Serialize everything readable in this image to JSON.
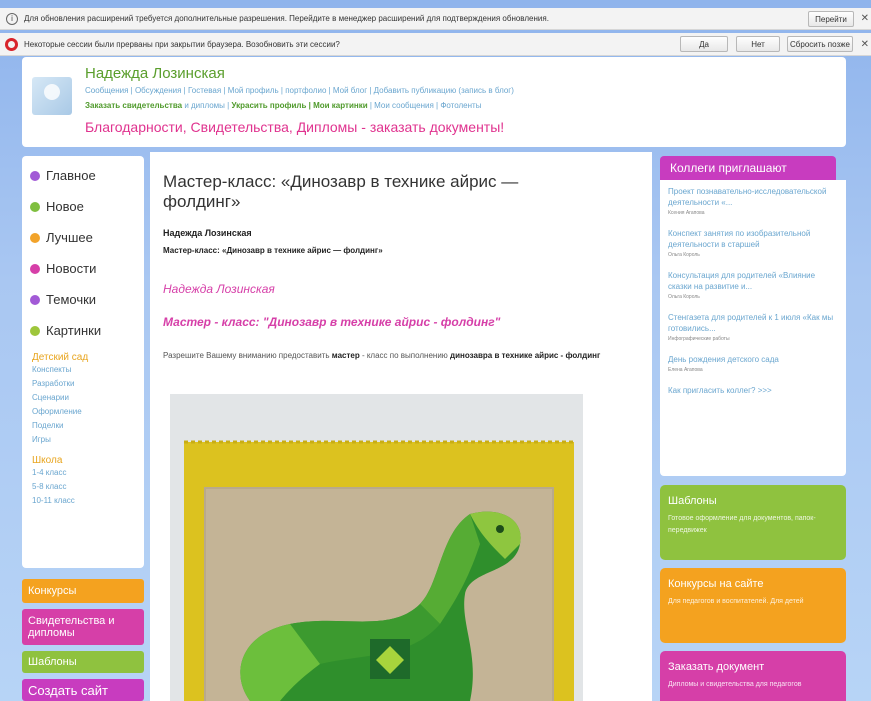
{
  "browser": {
    "bar1_text": "Для обновления расширений требуется дополнительные разрешения. Перейдите в менеджер расширений для подтверждения обновления.",
    "bar1_button": "Перейти",
    "bar2_text": "Некоторые сессии были прерваны при закрытии браузера. Возобновить эти сессии?",
    "bar2_buttons": [
      "Да",
      "Нет",
      "Сбросить позже"
    ],
    "info_icon": "i"
  },
  "header": {
    "user_name": "Надежда Лозинская",
    "links_line1": "Сообщения | Обсуждения | Гостевая | Мой профиль | портфолио | Мой блог | Добавить публикацию (запись в блог)",
    "links_line2_green1": "Заказать свидетельства",
    "links_line2_blue1": " и дипломы | ",
    "links_line2_green2": "Украсить профиль | Мои картинки",
    "links_line2_blue2": " | Мои сообщения | Фотоленты",
    "promo": "Благодарности, Свидетельства, Дипломы - заказать документы!"
  },
  "left_nav": {
    "items": [
      {
        "label": "Главное",
        "color": "#a25ad6"
      },
      {
        "label": "Новое",
        "color": "#7fbf3f"
      },
      {
        "label": "Лучшее",
        "color": "#f2a32a"
      },
      {
        "label": "Новости",
        "color": "#d63fa8"
      },
      {
        "label": "Темочки",
        "color": "#a25ad6"
      },
      {
        "label": "Картинки",
        "color": "#9ec63b"
      }
    ],
    "section1": {
      "title": "Детский сад",
      "links": [
        "Конспекты",
        "Разработки",
        "Сценарии",
        "Оформление",
        "Поделки",
        "Игры"
      ]
    },
    "section2": {
      "title": "Школа",
      "links": [
        "1-4 класс",
        "5-8 класс",
        "10-11 класс"
      ]
    },
    "buttons": [
      {
        "label": "Конкурсы",
        "color": "#f4a21f"
      },
      {
        "label": "Свидетельства и дипломы",
        "color": "#d63fa8"
      },
      {
        "label": "Шаблоны",
        "color": "#8fc23f"
      },
      {
        "label": "Создать сайт",
        "color": "#c83cbf"
      }
    ]
  },
  "article": {
    "title": "Мастер-класс: «Динозавр в технике айрис — фолдинг»",
    "author": "Надежда Лозинская",
    "subtitle": "Мастер-класс: «Динозавр в технике айрис — фолдинг»",
    "author_pink": "Надежда Лозинская",
    "mk_pink": "Мастер - класс: \"Динозавр в технике айрис - фолдинг\"",
    "intro_prefix": "Разрешите Вашему вниманию предоставить ",
    "intro_bold1": "мастер",
    "intro_mid": " - класс по выполнению ",
    "intro_bold2": "динозавра в технике айрис - фолдинг"
  },
  "colleagues": {
    "heading": "Коллеги приглашают",
    "items": [
      {
        "link": "Проект познавательно-исследовательской деятельности «...",
        "sub": "Ксения Агапова"
      },
      {
        "link": "Конспект занятия по изобразительной деятельности в старшей",
        "sub": "Ольга Король"
      },
      {
        "link": "Консультация для родителей «Влияние сказки на развитие и...",
        "sub": "Ольга Король"
      },
      {
        "link": "Стенгазета для родителей к 1 июля «Как мы готовились...",
        "sub": "Инфографические работы"
      },
      {
        "link": "День рождения детского сада",
        "sub": "Елена Агапова"
      },
      {
        "link": "Как пригласить коллег? >>>",
        "sub": ""
      }
    ]
  },
  "promo_cards": [
    {
      "title": "Шаблоны",
      "desc": "Готовое оформление для документов, папок-передвижек",
      "color": "#8fc23f"
    },
    {
      "title": "Конкурсы на сайте",
      "desc": "Для педагогов и воспитателей. Для детей",
      "color": "#f4a21f"
    },
    {
      "title": "Заказать документ",
      "desc": "Дипломы и свидетельства для педагогов",
      "color": "#d63fa8"
    }
  ]
}
